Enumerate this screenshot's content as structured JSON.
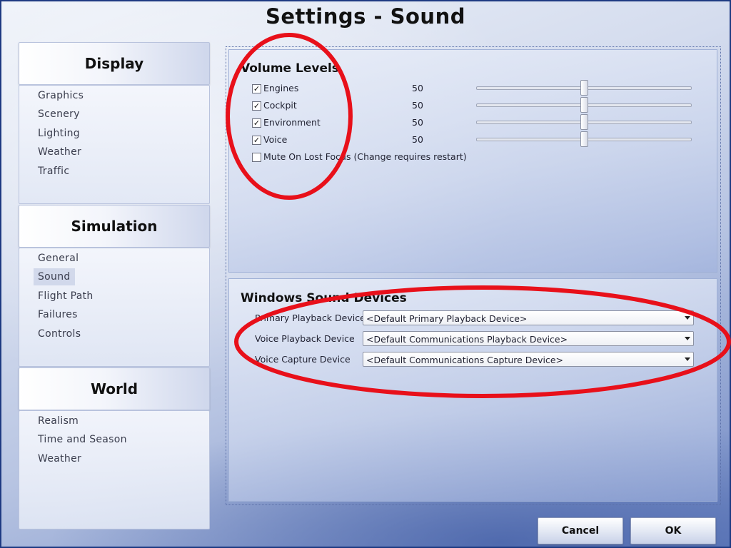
{
  "window": {
    "title": "Settings - Sound"
  },
  "sidebar": {
    "categories": [
      {
        "label": "Display",
        "items": [
          "Graphics",
          "Scenery",
          "Lighting",
          "Weather",
          "Traffic"
        ]
      },
      {
        "label": "Simulation",
        "items": [
          "General",
          "Sound",
          "Flight Path",
          "Failures",
          "Controls"
        ]
      },
      {
        "label": "World",
        "items": [
          "Realism",
          "Time and Season",
          "Weather"
        ]
      }
    ],
    "selected": "Sound"
  },
  "volume": {
    "title": "Volume Levels",
    "channels": [
      {
        "label": "Engines",
        "checked": true,
        "value": "50"
      },
      {
        "label": "Cockpit",
        "checked": true,
        "value": "50"
      },
      {
        "label": "Environment",
        "checked": true,
        "value": "50"
      },
      {
        "label": "Voice",
        "checked": true,
        "value": "50"
      }
    ],
    "mute_option": {
      "label": "Mute On Lost Focus (Change requires restart)",
      "checked": false
    }
  },
  "devices": {
    "title": "Windows Sound Devices",
    "rows": [
      {
        "label": "Primary Playback Device",
        "value": "<Default Primary Playback Device>"
      },
      {
        "label": "Voice Playback Device",
        "value": "<Default Communications Playback Device>"
      },
      {
        "label": "Voice Capture Device",
        "value": "<Default Communications Capture Device>"
      }
    ]
  },
  "buttons": {
    "cancel": "Cancel",
    "ok": "OK"
  },
  "colors": {
    "annotation": "#e8101a",
    "accent": "#1e3a82"
  },
  "icons": {
    "checkbox_mark": "✓",
    "dropdown": "chevron-down-icon"
  }
}
